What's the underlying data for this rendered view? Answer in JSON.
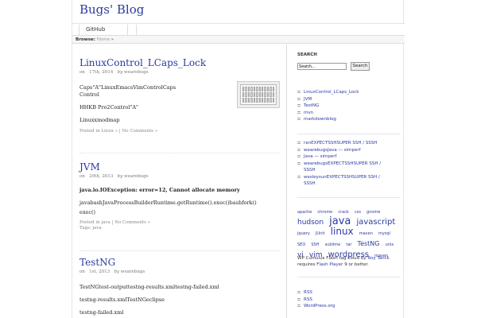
{
  "site": {
    "title": "Bugs' Blog"
  },
  "nav": {
    "items": [
      "GitHub"
    ]
  },
  "breadcrumb": {
    "label": "Browse:",
    "home": "Home",
    "sep": "»"
  },
  "posts": [
    {
      "title": "LinuxControl_LCaps_Lock",
      "meta_on": "on",
      "date": "17th, 2014",
      "meta_by": "by",
      "author": "wearebugs",
      "lines": [
        "Caps\"A\"LinuxEmacsVimControlCaps",
        "Control",
        "HHKB Pro2Control\"A\"",
        "Linuxxmodmap"
      ],
      "footer": "Posted in Linux »  | No Comments »"
    },
    {
      "title": "JVM",
      "meta_on": "on",
      "date": "29th, 2013",
      "meta_by": "by",
      "author": "wearebugs",
      "lines": [
        "java.io.IOException: error=12, Cannot allocate memory",
        "javabashJavaProcessBuilderRuntime.getRuntime().exec()bashfork()",
        "exec()"
      ],
      "footer": "Posted in java | No Comments »",
      "tags": "Tags: java"
    },
    {
      "title": "TestNG",
      "meta_on": "on",
      "date": "1st, 2013",
      "meta_by": "by",
      "author": "wearebugs",
      "lines": [
        "TestNGtest-outputtestng-results.xmltestng-failed.xml",
        "testng-results.xmlTestNGeclipse",
        "testng-failed.xml"
      ]
    }
  ],
  "sidebar": {
    "search": {
      "heading": "SEARCH",
      "value": "Search...",
      "button": "Search"
    },
    "recent_posts": [
      "LinuxControl_LCaps_Lock",
      "JVM",
      "TestNG",
      "mvn",
      "markdownblog"
    ],
    "recent_comments": [
      [
        "ranEXPECTSSHSUPER SSH / SSSH"
      ],
      [
        "wearebugsJava — simperf"
      ],
      [
        "Java — simperf"
      ],
      [
        "wearebugsEXPECTSSHSUPER SSH /",
        "SSSH"
      ],
      [
        "wesleysunEXPECTSSHSUPER SSH /",
        "SSSH"
      ]
    ],
    "tag_cloud": [
      {
        "t": "apache",
        "s": 5
      },
      {
        "t": "chrome",
        "s": 5
      },
      {
        "t": "crack",
        "s": 5
      },
      {
        "t": "css",
        "s": 5
      },
      {
        "t": "gnome",
        "s": 5
      },
      {
        "t": "hudson",
        "s": 9
      },
      {
        "t": "java",
        "s": 13
      },
      {
        "t": "javascript",
        "s": 10
      },
      {
        "t": "jquery",
        "s": 5
      },
      {
        "t": "JUnit",
        "s": 5
      },
      {
        "t": "linux",
        "s": 12
      },
      {
        "t": "maven",
        "s": 5
      },
      {
        "t": "mysql",
        "s": 5
      },
      {
        "t": "SEO",
        "s": 5
      },
      {
        "t": "SSH",
        "s": 5
      },
      {
        "t": "sublime",
        "s": 5
      },
      {
        "t": "tar",
        "s": 5
      },
      {
        "t": "TestNG",
        "s": 8
      },
      {
        "t": "unix",
        "s": 5
      },
      {
        "t": "vi",
        "s": 9
      },
      {
        "t": "vim",
        "s": 9
      },
      {
        "t": "wordpress",
        "s": 10
      },
      {
        "t": "maven",
        "s": 5
      }
    ],
    "cumulus": {
      "p1": "WP Cumulus Flash tag cloud by ",
      "a1": "Roy Tanck",
      "p2": " requires ",
      "a2": "Flash Player",
      "p3": " 9 or better."
    },
    "meta_links": [
      "RSS",
      "RSS",
      "WordPress.org"
    ]
  }
}
